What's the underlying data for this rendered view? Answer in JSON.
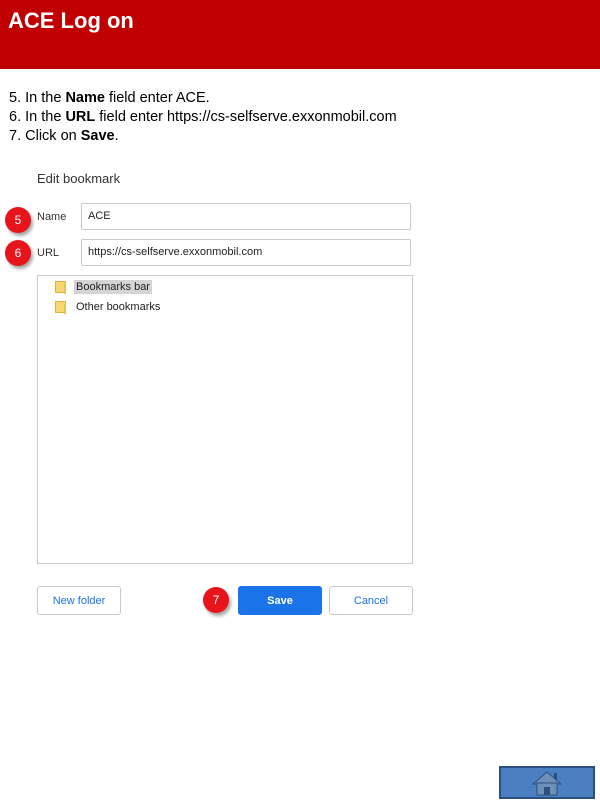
{
  "header": {
    "title": "ACE Log on"
  },
  "instructions": {
    "step5": {
      "prefix": "5. In the ",
      "bold": "Name",
      "suffix": " field enter ACE."
    },
    "step6": {
      "prefix": "6. In the ",
      "bold": "URL",
      "suffix": " field enter https://cs-selfserve.exxonmobil.com"
    },
    "step7": {
      "prefix": "7. Click on ",
      "bold": "Save",
      "suffix": "."
    }
  },
  "dialog": {
    "title": "Edit bookmark",
    "name_label": "Name",
    "name_value": "ACE",
    "url_label": "URL",
    "url_value": "https://cs-selfserve.exxonmobil.com",
    "folders": [
      {
        "label": "Bookmarks bar",
        "selected": true
      },
      {
        "label": "Other bookmarks",
        "selected": false
      }
    ],
    "new_folder_label": "New folder",
    "save_label": "Save",
    "cancel_label": "Cancel"
  },
  "badges": {
    "name_step": "5",
    "url_step": "6",
    "save_step": "7"
  },
  "nav": {
    "home_icon": "home-icon"
  },
  "colors": {
    "header_bg": "#c00000",
    "badge": "#e8141b",
    "primary": "#1a73e8",
    "home_button": "#4a7fc1"
  }
}
